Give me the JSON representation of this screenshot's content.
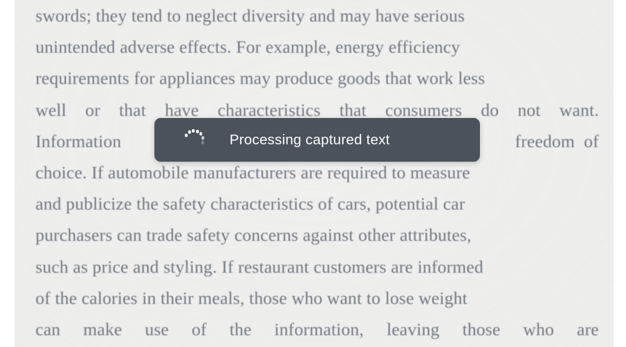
{
  "app": {
    "background_color": "#ffffff",
    "page_color": "#f0f0ef"
  },
  "document": {
    "text_color": "#6d7480",
    "lines": [
      "swords; they tend to neglect diversity and may have serious",
      "unintended adverse effects. For example, energy efficiency",
      "requirements for appliances may produce goods that work less",
      "well or that have characteristics that consumers do not want.",
      "Information",
      "freedom  of",
      "choice. If automobile manufacturers are required to measure",
      "and publicize the safety characteristics of cars, potential car",
      "purchasers can trade safety concerns against other attributes,",
      "such as price and styling. If restaurant customers are informed",
      "of the calories in their meals, those who want to lose weight",
      "can  make  use  of  the  information,  leaving  those  who  are"
    ],
    "line4_words": [
      "well",
      "or",
      "that",
      "have",
      "characteristics",
      "that",
      "consumers",
      "do",
      "not",
      "want."
    ],
    "line12_words": [
      "can",
      "make",
      "use",
      "of",
      "the",
      "information,",
      "leaving",
      "those",
      "who",
      "are"
    ]
  },
  "toast": {
    "message": "Processing captured text",
    "background_color": "#4b525b",
    "text_color": "#fdfdfd",
    "spinner_icon": "loading-spinner-icon",
    "spinner_dot_count": 7
  }
}
